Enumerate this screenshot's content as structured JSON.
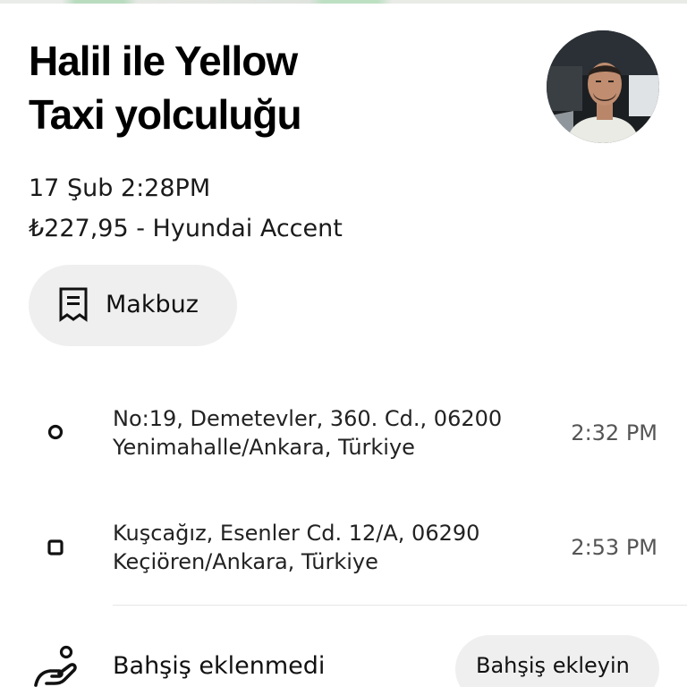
{
  "trip": {
    "title_line1": "Halil ile Yellow",
    "title_line2": "Taxi yolculuğu",
    "datetime": "17 Şub 2:28PM",
    "price_vehicle": "₺227,95 - Hyundai Accent"
  },
  "receipt_button": {
    "label": "Makbuz",
    "icon": "receipt-icon"
  },
  "stops": [
    {
      "kind": "pickup",
      "icon": "circle-marker-icon",
      "address_line1": "No:19, Demetevler, 360. Cd., 06200",
      "address_line2": "Yenimahalle/Ankara, Türkiye",
      "time": "2:32 PM"
    },
    {
      "kind": "dropoff",
      "icon": "square-marker-icon",
      "address_line1": "Kuşcağız, Esenler Cd. 12/A, 06290",
      "address_line2": "Keçiören/Ankara, Türkiye",
      "time": "2:53 PM"
    }
  ],
  "tip": {
    "icon": "tip-hand-icon",
    "status": "Bahşiş eklenmedi",
    "button_label": "Bahşiş ekleyin"
  }
}
